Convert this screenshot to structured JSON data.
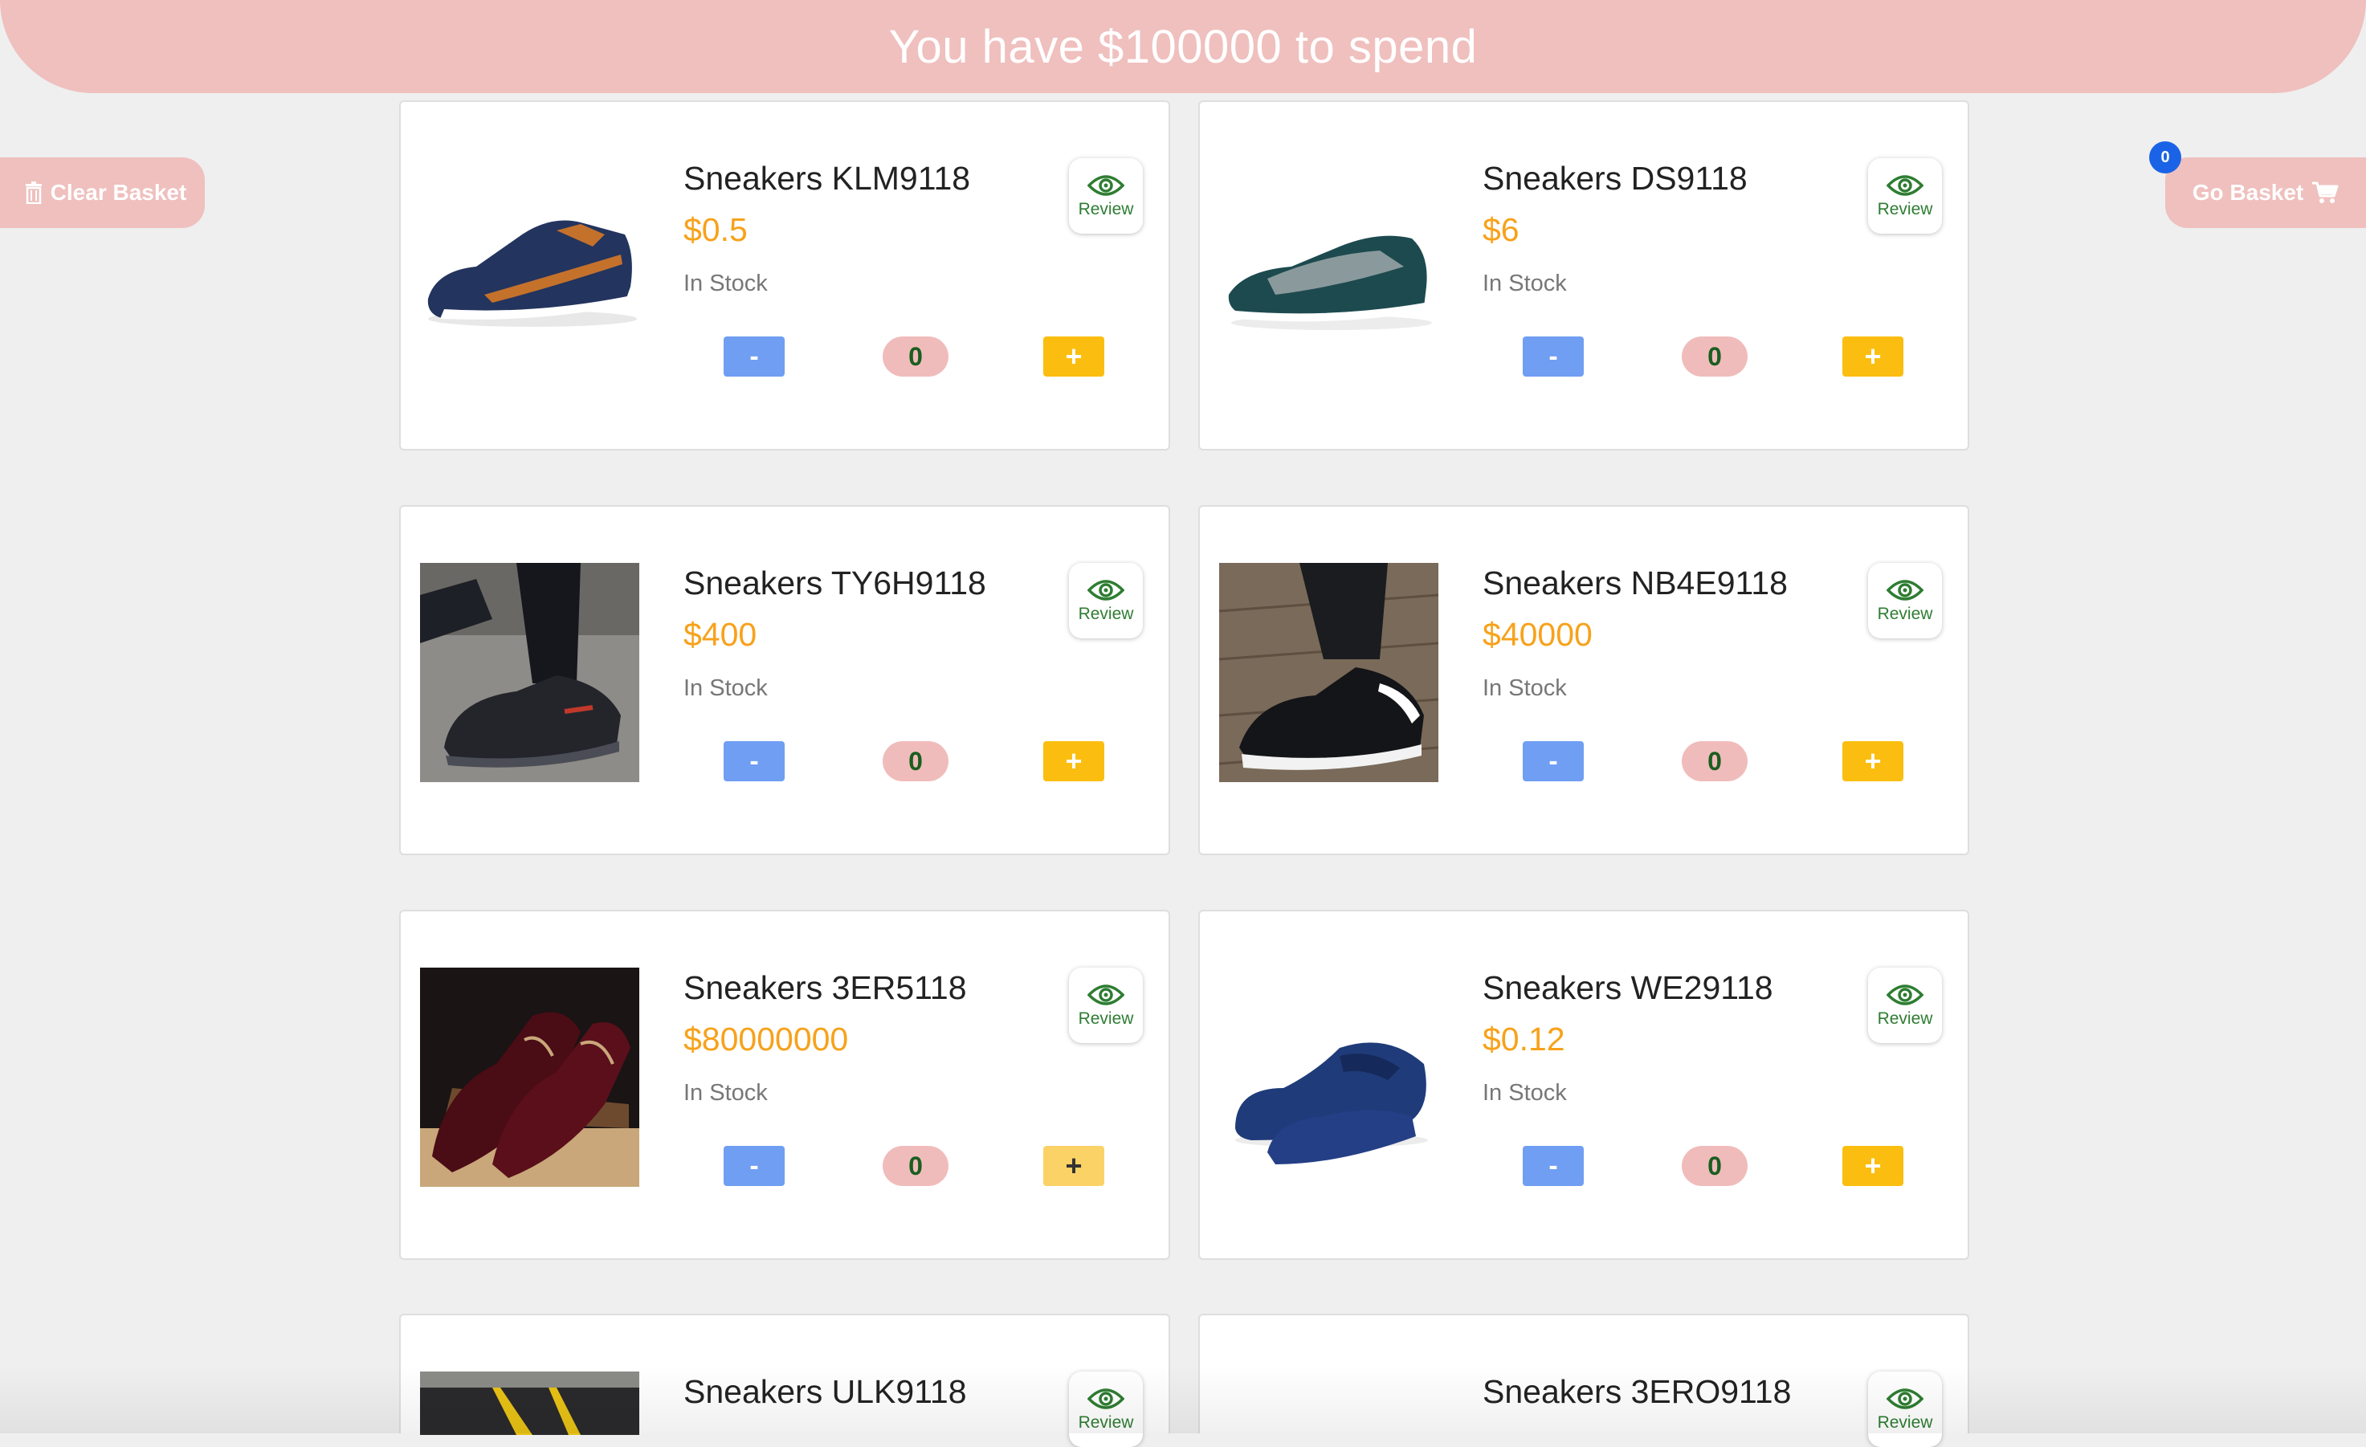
{
  "banner": {
    "text": "You have $100000 to spend"
  },
  "clear_basket": {
    "label": "Clear Basket",
    "icon": "trash-icon"
  },
  "go_basket": {
    "label": "Go Basket",
    "icon": "cart-icon",
    "count": "0"
  },
  "colors": {
    "accent_pink": "#efc0be",
    "price": "#f7a21b",
    "minus": "#6f9ef3",
    "plus": "#fbbe10",
    "badge": "#1a63e6",
    "review_green": "#2e7d32"
  },
  "products": [
    {
      "name": "Sneakers KLM9118",
      "price": "$0.5",
      "stock": "In Stock",
      "review": "Review",
      "minus": "-",
      "qty": "0",
      "plus": "+"
    },
    {
      "name": "Sneakers DS9118",
      "price": "$6",
      "stock": "In Stock",
      "review": "Review",
      "minus": "-",
      "qty": "0",
      "plus": "+"
    },
    {
      "name": "Sneakers TY6H9118",
      "price": "$400",
      "stock": "In Stock",
      "review": "Review",
      "minus": "-",
      "qty": "0",
      "plus": "+"
    },
    {
      "name": "Sneakers NB4E9118",
      "price": "$40000",
      "stock": "In Stock",
      "review": "Review",
      "minus": "-",
      "qty": "0",
      "plus": "+"
    },
    {
      "name": "Sneakers 3ER5118",
      "price": "$80000000",
      "stock": "In Stock",
      "review": "Review",
      "minus": "-",
      "qty": "0",
      "plus": "+"
    },
    {
      "name": "Sneakers WE29118",
      "price": "$0.12",
      "stock": "In Stock",
      "review": "Review",
      "minus": "-",
      "qty": "0",
      "plus": "+"
    },
    {
      "name": "Sneakers ULK9118",
      "review": "Review"
    },
    {
      "name": "Sneakers 3ERO9118",
      "review": "Review"
    }
  ]
}
